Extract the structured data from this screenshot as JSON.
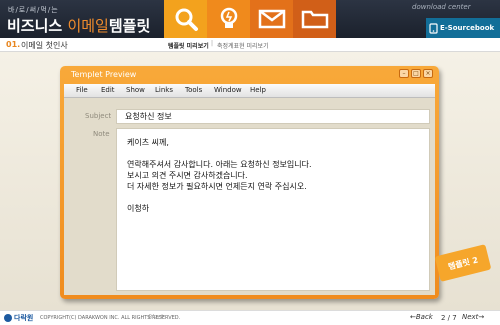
{
  "header": {
    "brand_sub": "바/로/써/먹/는",
    "brand_main": "비즈니스",
    "brand_accent": "이메일",
    "brand_end": "템플릿",
    "download": "download center",
    "esourcebook": "E-Sourcebook",
    "tiles": [
      "search-icon",
      "lightbulb-icon",
      "mail-icon",
      "folder-icon"
    ]
  },
  "breadcrumb": {
    "number": "01.",
    "title": "이메일 첫인사",
    "current": "템플릿 미리보기",
    "separator": "|",
    "sub": "축정계표현 미리보기"
  },
  "window": {
    "title": "Templet Preview",
    "menu": [
      "File",
      "Edit",
      "Show",
      "Links",
      "Tools",
      "Window",
      "Help"
    ],
    "subject_label": "Subject",
    "subject_value": "요청하신 정보",
    "note_label": "Note",
    "note": {
      "greeting": "케이츠 씨께,",
      "line1": "연락해주셔서 감사합니다. 아래는 요청하신 정보입니다.",
      "line2": "보시고 의견 주시면 감사하겠습니다.",
      "line3": "더 자세한 정보가 필요하시면 언제든지 연락 주십시오.",
      "sign": "이청하"
    }
  },
  "sticker": "템플릿 2",
  "footer": {
    "logo": "다락원",
    "copyright": "COPYRIGHT(C) DARAKWON INC. ALL RIGHTS RESERVED.",
    "scribble": "Black",
    "back": "←Back",
    "page": "2 / 7",
    "next": "Next→"
  },
  "colors": {
    "orange": "#f08c1e",
    "header_dark": "#232a36",
    "tile1": "#f3a21d",
    "tile2": "#f08a1c",
    "tile3": "#e3711a",
    "tile4": "#d15f18",
    "esource_blue": "#126e98"
  }
}
